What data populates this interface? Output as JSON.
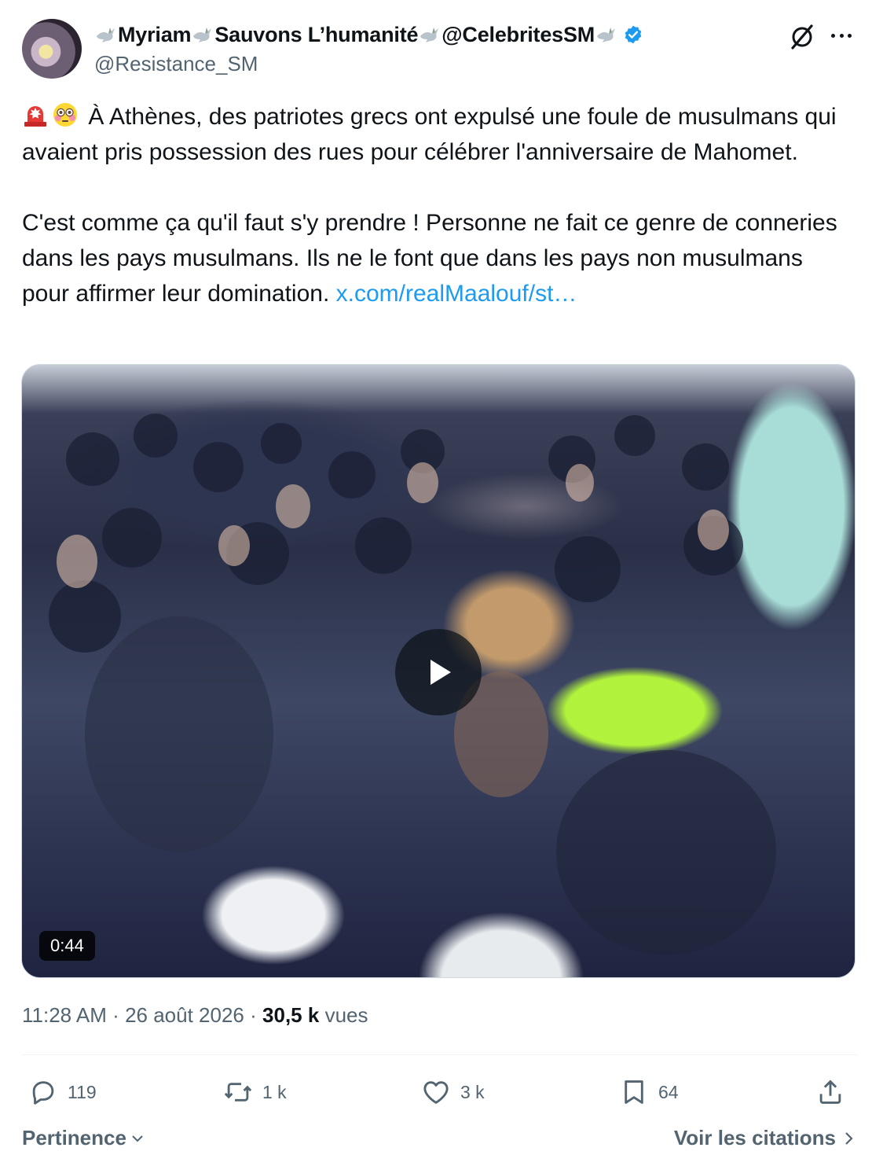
{
  "author": {
    "name_segments": [
      "Myriam",
      "Sauvons L’humanité",
      "@CelebritesSM"
    ],
    "handle": "@Resistance_SM",
    "verified": true
  },
  "icons": {
    "name_ornament": "dove-icon",
    "verified": "verified-badge-icon",
    "grok": "grok-icon",
    "more": "more-icon",
    "emoji_1": "police-light-emoji",
    "emoji_2": "flushed-face-emoji",
    "play": "play-icon",
    "reply": "reply-icon",
    "repost": "repost-icon",
    "like": "like-icon",
    "bookmark": "bookmark-icon",
    "share": "share-icon"
  },
  "tweet": {
    "paragraph1": "À Athènes, des patriotes grecs ont expulsé une foule de musulmans qui avaient pris possession des rues pour célébrer l'anniversaire de Mahomet.",
    "paragraph2": "C'est comme ça qu'il faut s'y prendre ! Personne ne fait ce genre de conneries dans les pays musulmans. Ils ne le font que dans les pays non musulmans pour affirmer leur domination.",
    "link_text": "x.com/realMaalouf/st…"
  },
  "media": {
    "duration": "0:44"
  },
  "meta": {
    "time": "11:28 AM",
    "date": "26 août 2026",
    "views_count": "30,5 k",
    "views_label": "vues",
    "separator": "·"
  },
  "actions": {
    "replies": "119",
    "reposts": "1 k",
    "likes": "3 k",
    "bookmarks": "64"
  },
  "footer": {
    "sort_label": "Pertinence",
    "quotes_label": "Voir les citations"
  },
  "colors": {
    "text_primary": "#0f1419",
    "text_secondary": "#536471",
    "link": "#1d9bf0",
    "verified": "#1d9bf0",
    "divider": "#eff3f4"
  }
}
